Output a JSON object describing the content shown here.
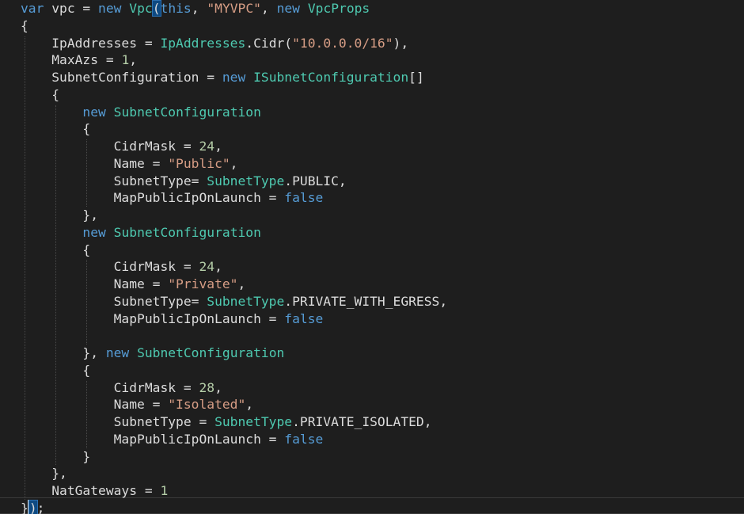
{
  "editor": {
    "colors": {
      "background": "#1e1e1e",
      "keyword": "#569cd6",
      "type": "#4ec9b0",
      "string": "#d69d85",
      "number": "#b5cea8",
      "identifier": "#dcdcdc"
    },
    "lines": [
      [
        {
          "t": "var",
          "c": "kw"
        },
        {
          "t": " vpc = ",
          "c": "id"
        },
        {
          "t": "new",
          "c": "kw"
        },
        {
          "t": " ",
          "c": "id"
        },
        {
          "t": "Vpc",
          "c": "ty"
        },
        {
          "t": "(",
          "c": "id",
          "hl": true
        },
        {
          "t": "this",
          "c": "kw"
        },
        {
          "t": ", ",
          "c": "id"
        },
        {
          "t": "\"MYVPC\"",
          "c": "st"
        },
        {
          "t": ", ",
          "c": "id"
        },
        {
          "t": "new",
          "c": "kw"
        },
        {
          "t": " ",
          "c": "id"
        },
        {
          "t": "VpcProps",
          "c": "ty"
        }
      ],
      [
        {
          "t": "{",
          "c": "id"
        }
      ],
      [
        {
          "t": "    IpAddresses = ",
          "c": "id"
        },
        {
          "t": "IpAddresses",
          "c": "ty"
        },
        {
          "t": ".Cidr(",
          "c": "id"
        },
        {
          "t": "\"10.0.0.0/16\"",
          "c": "st"
        },
        {
          "t": "),",
          "c": "id"
        }
      ],
      [
        {
          "t": "    MaxAzs = ",
          "c": "id"
        },
        {
          "t": "1",
          "c": "nu"
        },
        {
          "t": ",",
          "c": "id"
        }
      ],
      [
        {
          "t": "    SubnetConfiguration = ",
          "c": "id"
        },
        {
          "t": "new",
          "c": "kw"
        },
        {
          "t": " ",
          "c": "id"
        },
        {
          "t": "ISubnetConfiguration",
          "c": "ty"
        },
        {
          "t": "[]",
          "c": "id"
        }
      ],
      [
        {
          "t": "    {",
          "c": "id"
        }
      ],
      [
        {
          "t": "        ",
          "c": "id"
        },
        {
          "t": "new",
          "c": "kw"
        },
        {
          "t": " ",
          "c": "id"
        },
        {
          "t": "SubnetConfiguration",
          "c": "ty"
        }
      ],
      [
        {
          "t": "        {",
          "c": "id"
        }
      ],
      [
        {
          "t": "            CidrMask = ",
          "c": "id"
        },
        {
          "t": "24",
          "c": "nu"
        },
        {
          "t": ",",
          "c": "id"
        }
      ],
      [
        {
          "t": "            Name = ",
          "c": "id"
        },
        {
          "t": "\"Public\"",
          "c": "st"
        },
        {
          "t": ",",
          "c": "id"
        }
      ],
      [
        {
          "t": "            SubnetType= ",
          "c": "id"
        },
        {
          "t": "SubnetType",
          "c": "ty"
        },
        {
          "t": ".PUBLIC,",
          "c": "id"
        }
      ],
      [
        {
          "t": "            MapPublicIpOnLaunch = ",
          "c": "id"
        },
        {
          "t": "false",
          "c": "kw"
        }
      ],
      [
        {
          "t": "        },",
          "c": "id"
        }
      ],
      [
        {
          "t": "        ",
          "c": "id"
        },
        {
          "t": "new",
          "c": "kw"
        },
        {
          "t": " ",
          "c": "id"
        },
        {
          "t": "SubnetConfiguration",
          "c": "ty"
        }
      ],
      [
        {
          "t": "        {",
          "c": "id"
        }
      ],
      [
        {
          "t": "            CidrMask = ",
          "c": "id"
        },
        {
          "t": "24",
          "c": "nu"
        },
        {
          "t": ",",
          "c": "id"
        }
      ],
      [
        {
          "t": "            Name = ",
          "c": "id"
        },
        {
          "t": "\"Private\"",
          "c": "st"
        },
        {
          "t": ",",
          "c": "id"
        }
      ],
      [
        {
          "t": "            SubnetType= ",
          "c": "id"
        },
        {
          "t": "SubnetType",
          "c": "ty"
        },
        {
          "t": ".PRIVATE_WITH_EGRESS,",
          "c": "id"
        }
      ],
      [
        {
          "t": "            MapPublicIpOnLaunch = ",
          "c": "id"
        },
        {
          "t": "false",
          "c": "kw"
        }
      ],
      [],
      [
        {
          "t": "        }, ",
          "c": "id"
        },
        {
          "t": "new",
          "c": "kw"
        },
        {
          "t": " ",
          "c": "id"
        },
        {
          "t": "SubnetConfiguration",
          "c": "ty"
        }
      ],
      [
        {
          "t": "        {",
          "c": "id"
        }
      ],
      [
        {
          "t": "            CidrMask = ",
          "c": "id"
        },
        {
          "t": "28",
          "c": "nu"
        },
        {
          "t": ",",
          "c": "id"
        }
      ],
      [
        {
          "t": "            Name = ",
          "c": "id"
        },
        {
          "t": "\"Isolated\"",
          "c": "st"
        },
        {
          "t": ",",
          "c": "id"
        }
      ],
      [
        {
          "t": "            SubnetType = ",
          "c": "id"
        },
        {
          "t": "SubnetType",
          "c": "ty"
        },
        {
          "t": ".PRIVATE_ISOLATED,",
          "c": "id"
        }
      ],
      [
        {
          "t": "            MapPublicIpOnLaunch = ",
          "c": "id"
        },
        {
          "t": "false",
          "c": "kw"
        }
      ],
      [
        {
          "t": "        }",
          "c": "id"
        }
      ],
      [
        {
          "t": "    },",
          "c": "id"
        }
      ],
      [
        {
          "t": "    NatGateways = ",
          "c": "id"
        },
        {
          "t": "1",
          "c": "nu"
        }
      ],
      [
        {
          "t": "}",
          "c": "id"
        },
        {
          "t": ")",
          "c": "id",
          "hl": true,
          "cursor": true
        },
        {
          "t": ";",
          "c": "id"
        }
      ]
    ]
  }
}
